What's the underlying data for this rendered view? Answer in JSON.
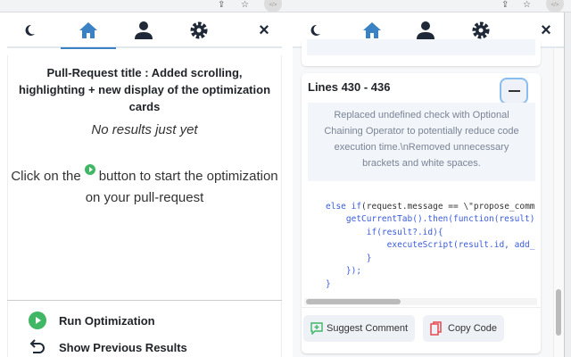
{
  "left": {
    "pr_title": "Pull-Request title : Added scrolling, highlighting + new display of the optimization cards",
    "no_results": "No results just yet",
    "hint_before": "Click on the",
    "hint_after": "button to start the optimization on your pull-request",
    "footer": {
      "run": "Run Optimization",
      "previous": "Show Previous Results"
    }
  },
  "right": {
    "card_title": "Lines 430 - 436",
    "description": "Replaced undefined check with Optional Chaining Operator to potentially reduce code execution time.\\nRemoved unnecessary brackets and white spaces.",
    "code_lines": [
      "else if(request.message == \\\"propose_comm",
      "    getCurrentTab().then(function(result)",
      "        if(result?.id){",
      "            executeScript(result.id, add_",
      "        }",
      "    });",
      "}"
    ],
    "suggest_label": "Suggest Comment",
    "copy_label": "Copy Code"
  },
  "nav": {
    "tabs": [
      "theme-toggle",
      "home",
      "profile",
      "settings"
    ],
    "active": "home",
    "close": "×"
  },
  "colors": {
    "accent": "#3b82c4",
    "green": "#3fb765",
    "copy_red": "#e5484d"
  }
}
